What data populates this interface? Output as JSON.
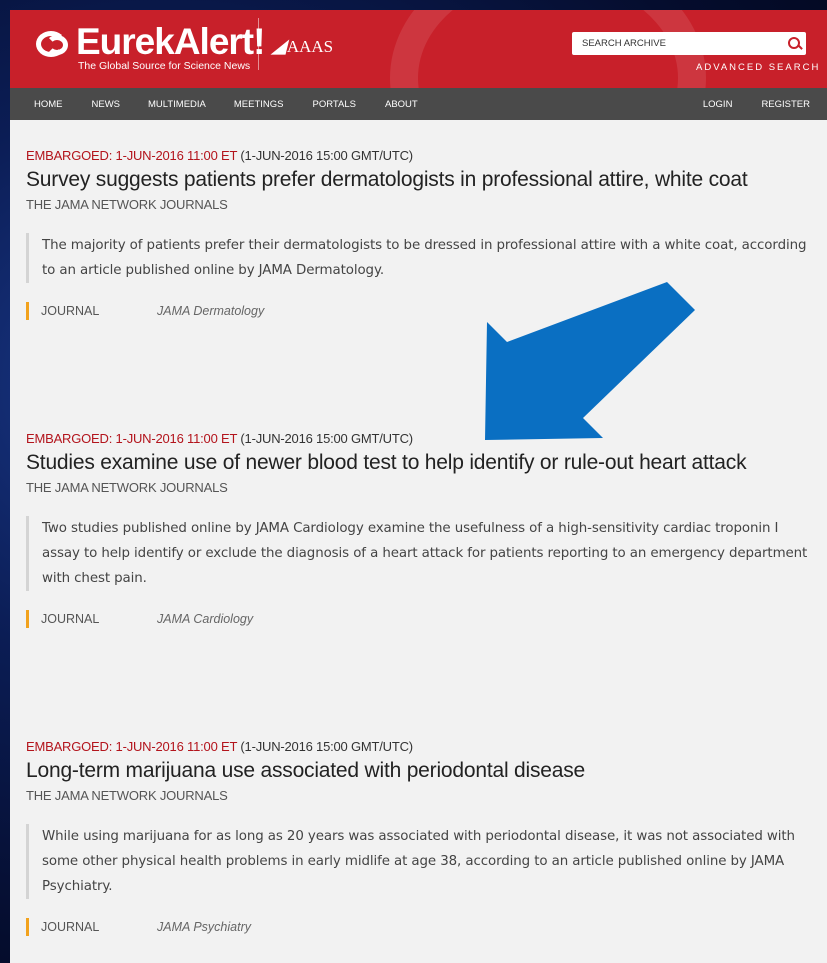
{
  "header": {
    "logo_text": "EurekAlert!",
    "logo_tagline": "The Global Source for Science News",
    "partner": "AAAS",
    "search_placeholder": "SEARCH ARCHIVE",
    "advanced_search": "ADVANCED SEARCH",
    "brand_color": "#c8202a"
  },
  "nav": {
    "left": [
      "HOME",
      "NEWS",
      "MULTIMEDIA",
      "MEETINGS",
      "PORTALS",
      "ABOUT"
    ],
    "right": [
      "LOGIN",
      "REGISTER"
    ]
  },
  "articles": [
    {
      "embargo_label": "EMBARGOED: 1-JUN-2016 11:00 ET",
      "embargo_gmt": "(1-JUN-2016 15:00 GMT/UTC)",
      "title": "Survey suggests patients prefer dermatologists in professional attire, white coat",
      "source": "THE JAMA NETWORK JOURNALS",
      "summary": "The majority of patients prefer their dermatologists to be dressed in professional attire with a white coat, according to an article published online by JAMA Dermatology.",
      "journal_label": "JOURNAL",
      "journal_name": "JAMA Dermatology"
    },
    {
      "embargo_label": "EMBARGOED: 1-JUN-2016 11:00 ET",
      "embargo_gmt": "(1-JUN-2016 15:00 GMT/UTC)",
      "title": "Studies examine use of newer blood test to help identify or rule-out heart attack",
      "source": "THE JAMA NETWORK JOURNALS",
      "summary": "Two studies published online by JAMA Cardiology examine the usefulness of a high-sensitivity cardiac troponin I assay to help identify or exclude the diagnosis of a heart attack for patients reporting to an emergency department with chest pain.",
      "journal_label": "JOURNAL",
      "journal_name": "JAMA Cardiology"
    },
    {
      "embargo_label": "EMBARGOED: 1-JUN-2016 11:00 ET",
      "embargo_gmt": "(1-JUN-2016 15:00 GMT/UTC)",
      "title": "Long-term marijuana use associated with periodontal disease",
      "source": "THE JAMA NETWORK JOURNALS",
      "summary": "While using marijuana for as long as 20 years was associated with periodontal disease, it was not associated with some other physical health problems in early midlife at age 38, according to an article published online by JAMA Psychiatry.",
      "journal_label": "JOURNAL",
      "journal_name": "JAMA Psychiatry"
    }
  ],
  "annotation": {
    "arrow_color": "#0a6fc2"
  }
}
